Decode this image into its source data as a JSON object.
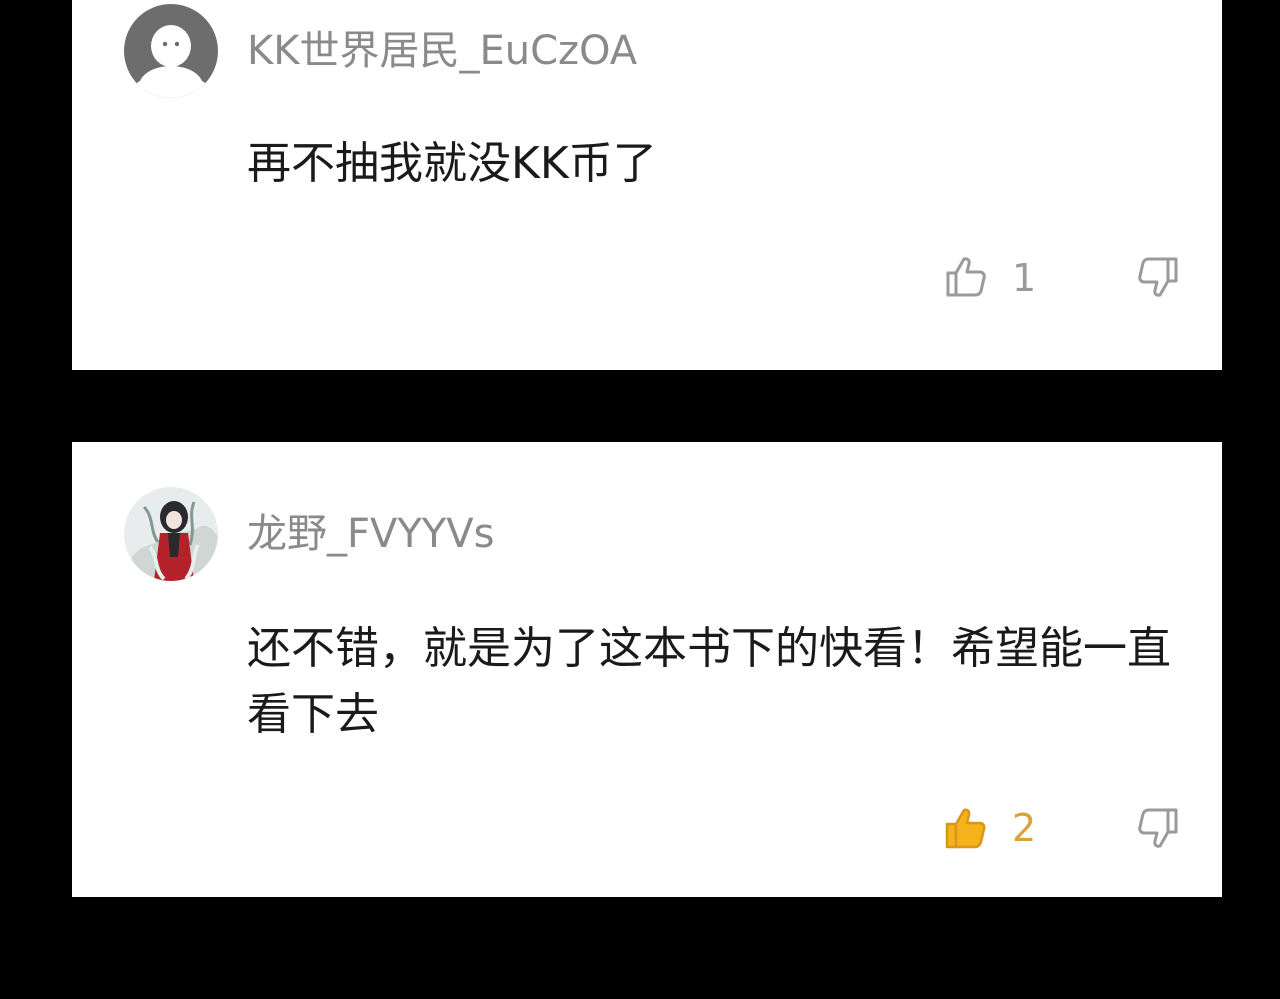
{
  "colors": {
    "background": "#000000",
    "card": "#ffffff",
    "username": "#8a8a8a",
    "comment_text": "#1a1a1a",
    "icon_inactive": "#9a9a9a",
    "like_active": "#f5b21b",
    "like_active_count": "#d9a33a"
  },
  "comments": [
    {
      "username": "KK世界居民_EuCzOA",
      "avatar": "default-ghost-avatar",
      "text": "再不抽我就没KK币了",
      "likes": "1",
      "liked": false
    },
    {
      "username": "龙野_FVYYVs",
      "avatar": "anime-character-avatar",
      "text": "还不错，就是为了这本书下的快看！希望能一直看下去",
      "likes": "2",
      "liked": true
    }
  ]
}
